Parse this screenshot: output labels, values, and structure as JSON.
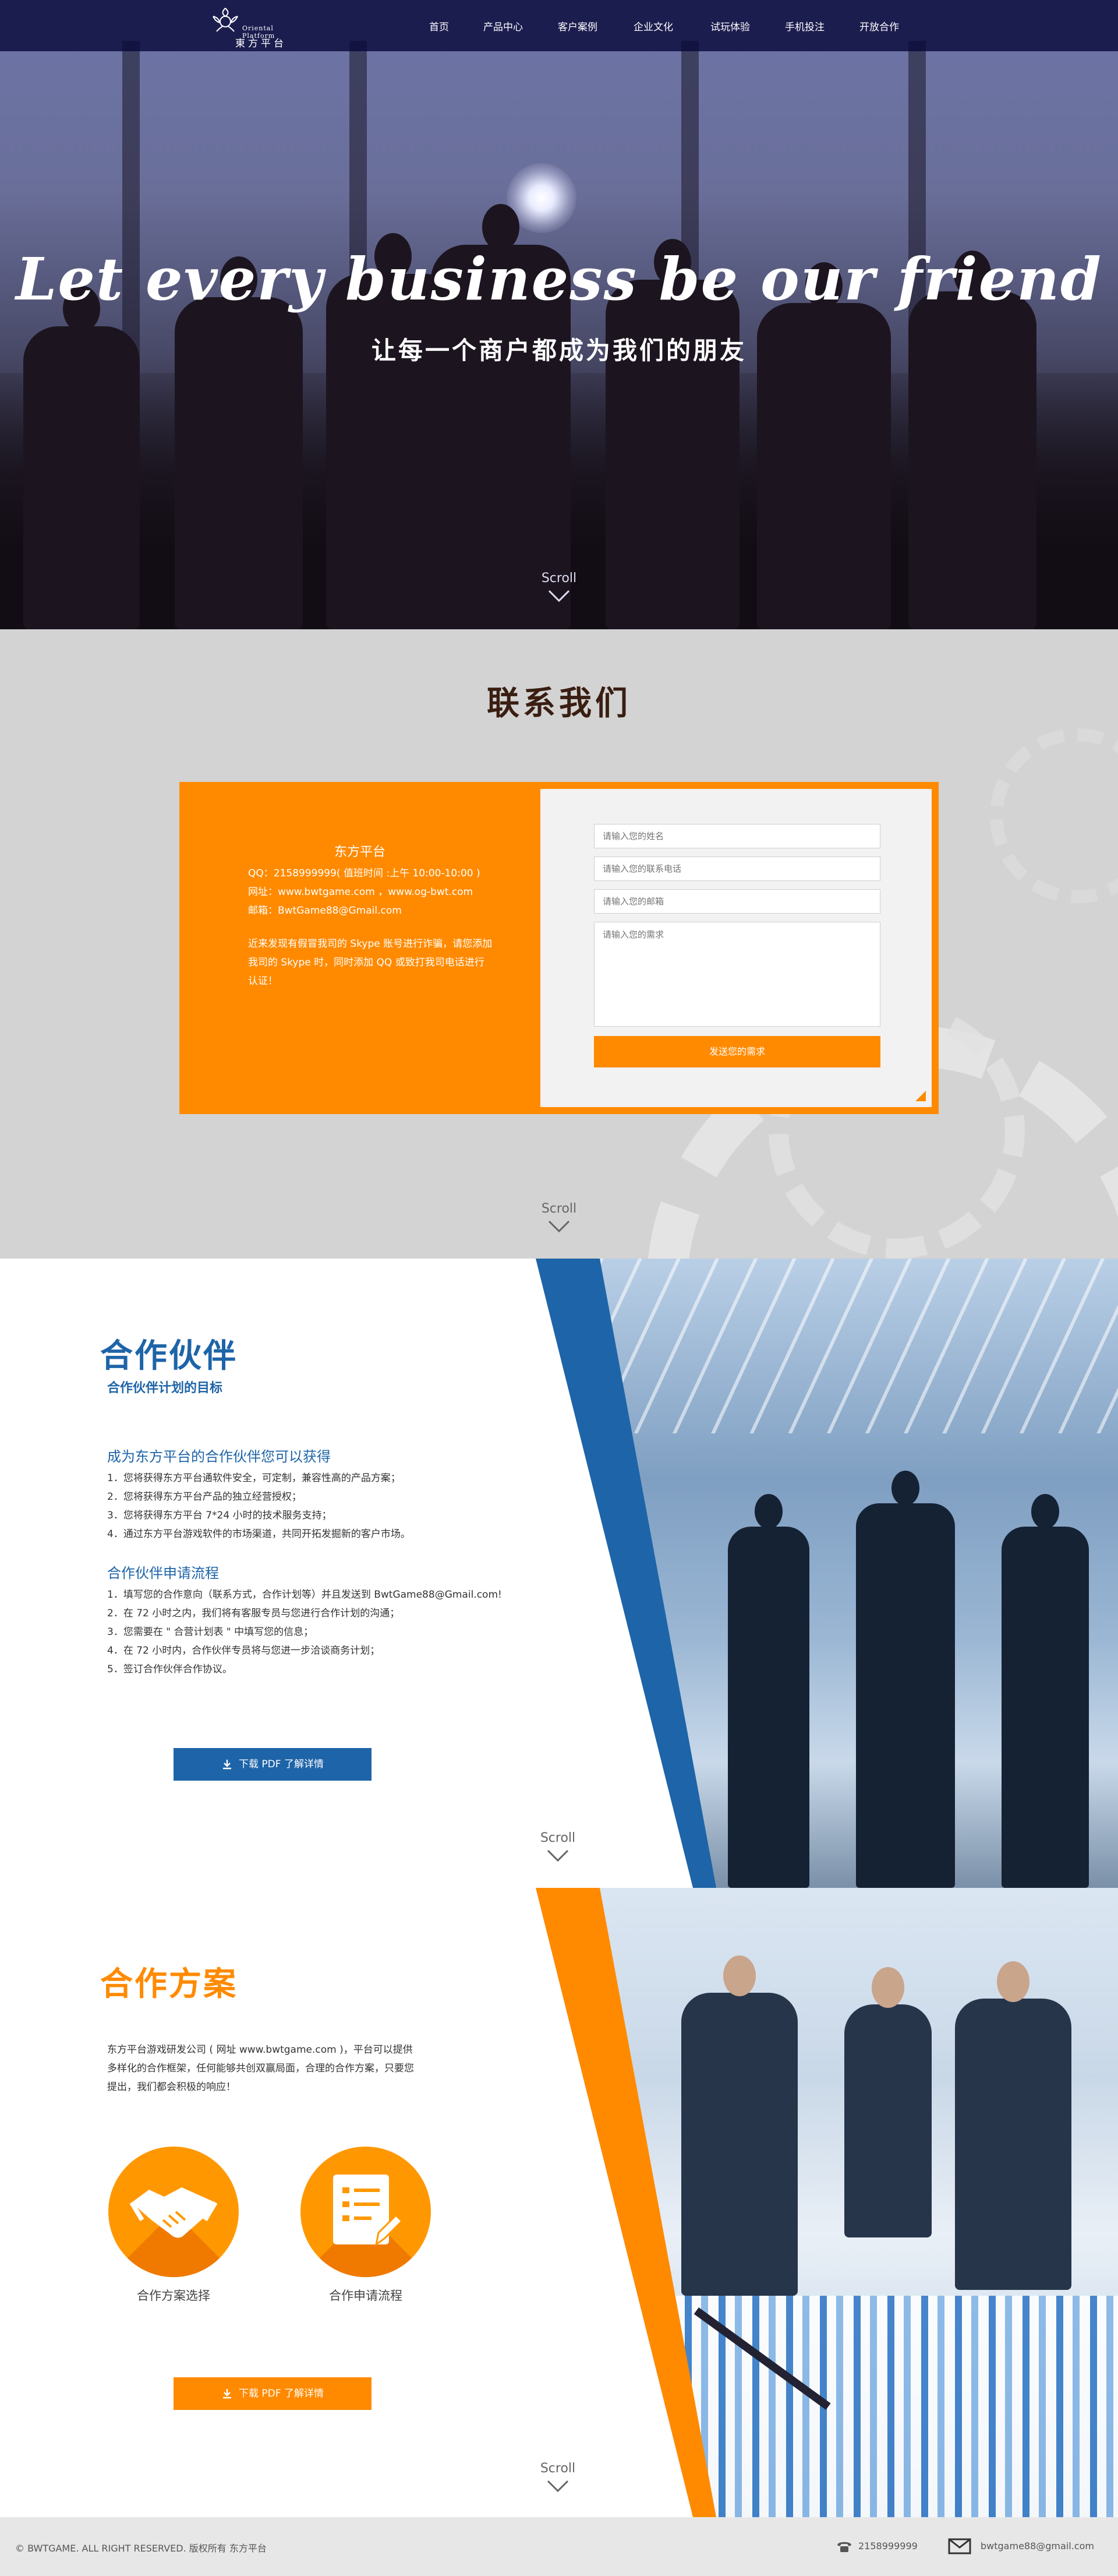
{
  "brand": {
    "logo_en": "Oriental Platform",
    "logo_cn": "東方平台"
  },
  "nav": {
    "items": [
      "首页",
      "产品中心",
      "客户案例",
      "企业文化",
      "试玩体验",
      "手机投注",
      "开放合作"
    ]
  },
  "hero": {
    "title": "Let every business be our friend",
    "subtitle": "让每一个商户都成为我们的朋友",
    "scroll": "Scroll"
  },
  "contact": {
    "title": "联系我们",
    "company": "东方平台",
    "qq": "QQ：2158999999( 值班时间 :上午 10:00-10:00 )",
    "website": "网址：www.bwtgame.com ，www.og-bwt.com",
    "email": "邮箱：BwtGame88@Gmail.com",
    "note": "近来发现有假冒我司的 Skype 账号进行诈骗，请您添加我司的 Skype 时，同时添加 QQ 或致打我司电话进行认证！",
    "form": {
      "name_placeholder": "请输入您的姓名",
      "phone_placeholder": "请输入您的联系电话",
      "email_placeholder": "请输入您的邮箱",
      "message_placeholder": "请输入您的需求",
      "send_label": "发送您的需求"
    },
    "scroll": "Scroll"
  },
  "partners": {
    "title": "合作伙伴",
    "subtitle": "合作伙伴计划的目标",
    "benefits_heading": "成为东方平台的合作伙伴您可以获得",
    "benefits": [
      "1．您将获得东方平台通软件安全，可定制，兼容性高的产品方案；",
      "2．您将获得东方平台产品的独立经营授权；",
      "3．您将获得东方平台 7*24 小时的技术服务支持；",
      "4．通过东方平台游戏软件的市场渠道，共同开拓发掘新的客户市场。"
    ],
    "process_heading": "合作伙伴申请流程",
    "process": [
      "1．填写您的合作意向（联系方式，合作计划等）并且发送到 BwtGame88@Gmail.com!",
      "2．在 72 小时之内，我们将有客服专员与您进行合作计划的沟通；",
      "3．您需要在 \" 合营计划表 \" 中填写您的信息；",
      "4．在 72 小时内，合作伙伴专员将与您进一步洽谈商务计划；",
      "5．签订合作伙伴合作协议。"
    ],
    "download_label": "下载 PDF 了解详情",
    "scroll": "Scroll"
  },
  "plan": {
    "title": "合作方案",
    "text": "东方平台游戏研发公司 ( 网址 www.bwtgame.com )，平台可以提供多样化的合作框架，任何能够共创双赢局面，合理的合作方案，只要您提出，我们都会积极的响应！",
    "card1_label": "合作方案选择",
    "card2_label": "合作申请流程",
    "download_label": "下载 PDF 了解详情",
    "scroll": "Scroll"
  },
  "footer": {
    "copyright": "© BWTGAME. ALL RIGHT RESERVED. 版权所有 东方平台",
    "phone": "2158999999",
    "email": "bwtgame88@gmail.com"
  },
  "colors": {
    "nav_bg": "#0a0a3c",
    "orange": "#ff8a00",
    "blue": "#1e64a8",
    "contact_title": "#3a1e12",
    "footer_bg": "#e7e7e7"
  }
}
